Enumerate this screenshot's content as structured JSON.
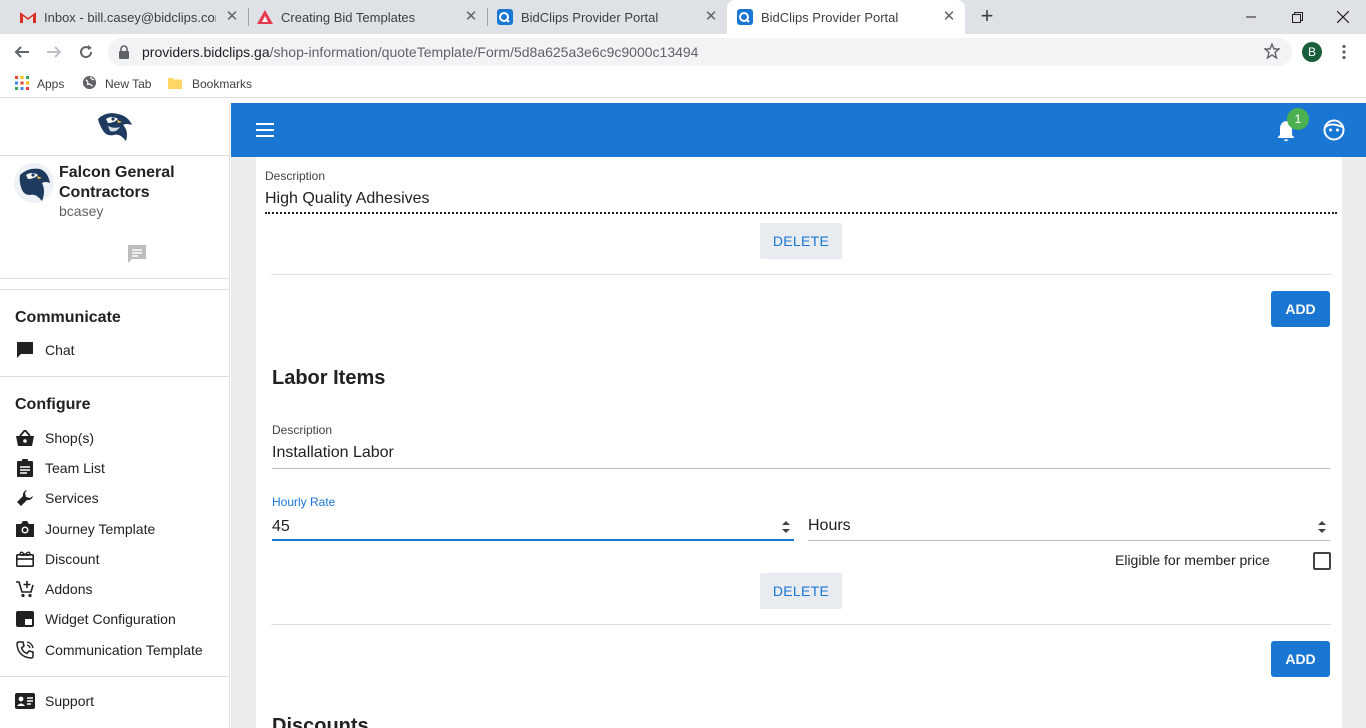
{
  "browser": {
    "tabs": [
      {
        "title": "Inbox - bill.casey@bidclips.com -",
        "icon": "gmail-icon"
      },
      {
        "title": "Creating Bid Templates",
        "icon": "creating-bid-icon"
      },
      {
        "title": "BidClips Provider Portal",
        "icon": "bidclips-icon"
      },
      {
        "title": "BidClips Provider Portal",
        "icon": "bidclips-icon"
      }
    ],
    "active_tab": 3,
    "url_host": "providers.bidclips.ga",
    "url_path": "/shop-information/quoteTemplate/Form/5d8a625a3e6c9c9000c13494",
    "profile_initial": "B",
    "bookmarks": [
      "Apps",
      "New Tab",
      "Bookmarks"
    ]
  },
  "sidebar": {
    "company": "Falcon General Contractors",
    "username": "bcasey",
    "sections": [
      {
        "heading": "Communicate",
        "items": [
          {
            "label": "Chat",
            "icon": "chat-icon"
          }
        ]
      },
      {
        "heading": "Configure",
        "items": [
          {
            "label": "Shop(s)",
            "icon": "shop-basket-icon"
          },
          {
            "label": "Team List",
            "icon": "clipboard-list-icon"
          },
          {
            "label": "Services",
            "icon": "wrench-icon"
          },
          {
            "label": "Journey Template",
            "icon": "camera-icon"
          },
          {
            "label": "Discount",
            "icon": "gift-card-icon"
          },
          {
            "label": "Addons",
            "icon": "cart-plus-icon"
          },
          {
            "label": "Widget Configuration",
            "icon": "widget-icon"
          },
          {
            "label": "Communication Template",
            "icon": "phone-icon"
          }
        ]
      },
      {
        "heading": "",
        "items": [
          {
            "label": "Support",
            "icon": "contact-card-icon"
          }
        ]
      }
    ]
  },
  "appbar": {
    "notification_count": "1",
    "color": "#1976d2"
  },
  "form": {
    "material_item": {
      "description_label": "Description",
      "description_value": "High Quality Adhesives",
      "delete_label": "DELETE"
    },
    "add_label": "ADD",
    "labor_section_title": "Labor Items",
    "labor_item": {
      "description_label": "Description",
      "description_value": "Installation Labor",
      "rate_label": "Hourly Rate",
      "rate_value": "45",
      "unit_value": "Hours",
      "member_price_label": "Eligible for member price",
      "member_price_checked": false,
      "delete_label": "DELETE"
    },
    "discounts_section_title": "Discounts"
  },
  "colors": {
    "accent": "#1976d2",
    "badge": "#4caf50",
    "content_bg": "#ececec"
  }
}
